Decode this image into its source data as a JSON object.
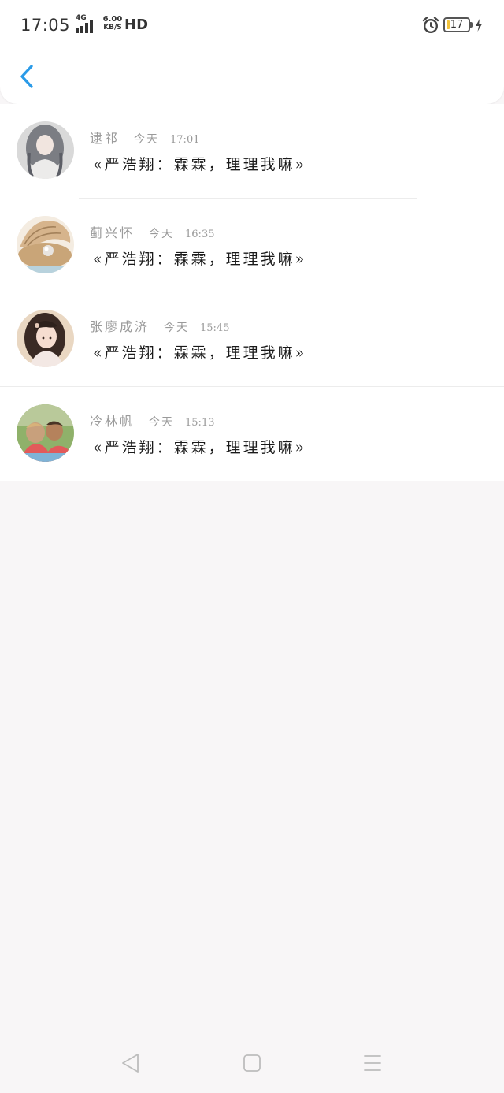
{
  "status_bar": {
    "time": "17:05",
    "network_type": "4G",
    "speed_value": "6.00",
    "speed_unit": "KB/S",
    "hd_label": "HD",
    "battery_level": "17",
    "battery_fraction": 0.17,
    "alarm_icon": "alarm-clock-icon",
    "charging_icon": "lightning-bolt-icon"
  },
  "header": {
    "back_icon": "chevron-left-icon",
    "accent_color": "#2b9be8"
  },
  "messages": [
    {
      "name": "逮祁",
      "date": "今天",
      "time": "17:01",
      "text": "«严浩翔：霖霖，理理我嘛»"
    },
    {
      "name": "蓟兴怀",
      "date": "今天",
      "time": "16:35",
      "text": "«严浩翔：霖霖，理理我嘛»"
    },
    {
      "name": "张廖成济",
      "date": "今天",
      "time": "15:45",
      "text": "«严浩翔：霖霖，理理我嘛»"
    },
    {
      "name": "冷林帆",
      "date": "今天",
      "time": "15:13",
      "text": "«严浩翔：霖霖，理理我嘛»"
    }
  ],
  "nav_bar": {
    "back_icon": "triangle-back-icon",
    "home_icon": "square-home-icon",
    "menu_icon": "three-lines-menu-icon"
  }
}
